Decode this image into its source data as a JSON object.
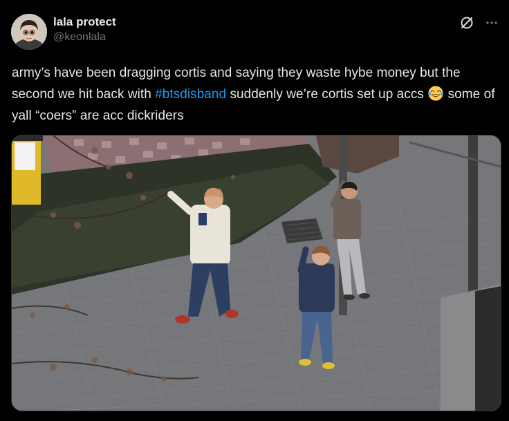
{
  "author": {
    "display_name": "lala protect",
    "handle": "@keonlala",
    "avatar_icon": "user-avatar"
  },
  "actions": {
    "grok_icon": "grok-icon",
    "more_icon": "more-options-icon"
  },
  "tweet": {
    "text_before_hashtag": "army’s have been dragging cortis and saying they waste hybe money but the second we hit back with ",
    "hashtag": "#btsdisband",
    "text_before_emoji": " suddenly we’re cortis set up accs ",
    "emoji": "face-with-tears-of-joy",
    "text_after_emoji": " some of yall “coers” are acc dickriders"
  },
  "media": {
    "type": "photo"
  },
  "colors": {
    "background": "#000000",
    "text": "#e7e9ea",
    "secondary": "#71767b",
    "link": "#1d9bf0"
  }
}
